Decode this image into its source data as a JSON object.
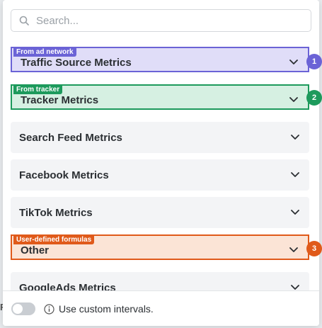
{
  "search": {
    "placeholder": "Search..."
  },
  "groups": [
    {
      "label": "Traffic Source Metrics",
      "tag": "From ad network",
      "badge": "1",
      "color": "#6b63d6",
      "fill": "#e0ddf8"
    },
    {
      "label": "Tracker Metrics",
      "tag": "From tracker",
      "badge": "2",
      "color": "#1d9a5c",
      "fill": "#d6f0e2"
    },
    {
      "label": "Search Feed Metrics"
    },
    {
      "label": "Facebook Metrics"
    },
    {
      "label": "TikTok Metrics"
    },
    {
      "label": "Other",
      "tag": "User-defined formulas",
      "badge": "3",
      "color": "#e05a1a",
      "fill": "#fbe4d6"
    },
    {
      "label": "GoogleAds Metrics"
    }
  ],
  "footer": {
    "custom_intervals_label": "Use custom intervals."
  }
}
